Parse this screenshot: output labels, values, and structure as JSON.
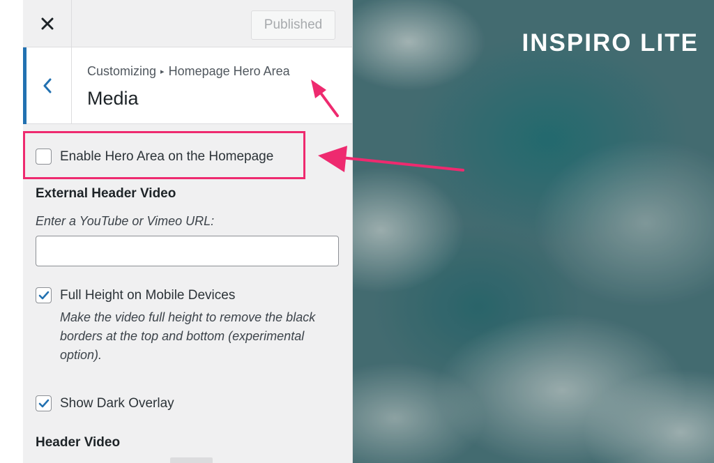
{
  "colors": {
    "accent": "#2271b1",
    "annotation": "#ee2a6f",
    "panel_background": "#f0f0f1"
  },
  "topbar": {
    "close_icon": "close-icon",
    "published_label": "Published"
  },
  "section_header": {
    "back_icon": "chevron-left-icon",
    "breadcrumb_root": "Customizing",
    "breadcrumb_separator": "▸",
    "breadcrumb_parent": "Homepage Hero Area",
    "title": "Media"
  },
  "controls": {
    "enable_hero": {
      "label": "Enable Hero Area on the Homepage",
      "checked": false
    },
    "external_video": {
      "heading": "External Header Video",
      "description": "Enter a YouTube or Vimeo URL:",
      "value": ""
    },
    "full_height": {
      "label": "Full Height on Mobile Devices",
      "checked": true,
      "description": "Make the video full height to remove the black borders at the top and bottom (experimental option)."
    },
    "dark_overlay": {
      "label": "Show Dark Overlay",
      "checked": true
    },
    "header_video": {
      "heading": "Header Video"
    }
  },
  "preview": {
    "site_title": "INSPIRO LITE"
  }
}
